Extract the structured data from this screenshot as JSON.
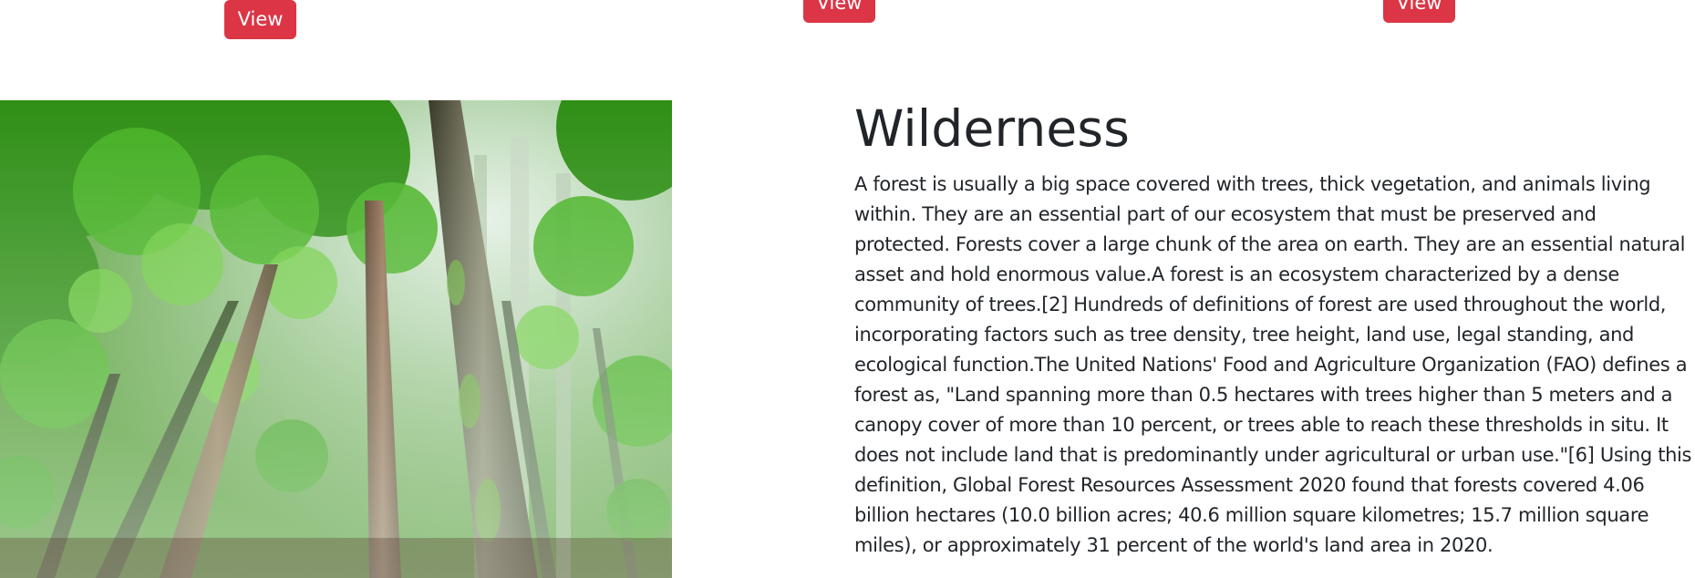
{
  "cards": {
    "buttons": [
      {
        "label": "View"
      },
      {
        "label": "View"
      },
      {
        "label": "View"
      }
    ]
  },
  "feature": {
    "image_description_icon": "forest-photo",
    "title": "Wilderness",
    "body": "A forest is usually a big space covered with trees, thick vegetation, and animals living within. They are an essential part of our ecosystem that must be preserved and protected. Forests cover a large chunk of the area on earth. They are an essential natural asset and hold enormous value.A forest is an ecosystem characterized by a dense community of trees.[2] Hundreds of definitions of forest are used throughout the world, incorporating factors such as tree density, tree height, land use, legal standing, and ecological function.The United Nations' Food and Agriculture Organization (FAO) defines a forest as, \"Land spanning more than 0.5 hectares with trees higher than 5 meters and a canopy cover of more than 10 percent, or trees able to reach these thresholds in situ. It does not include land that is predominantly under agricultural or urban use.\"[6] Using this definition, Global Forest Resources Assessment 2020 found that forests covered 4.06 billion hectares (10.0 billion acres; 40.6 million square kilometres; 15.7 million square miles), or approximately 31 percent of the world's land area in 2020."
  },
  "colors": {
    "button_bg": "#dc3545",
    "button_text": "#ffffff",
    "text": "#212529"
  }
}
